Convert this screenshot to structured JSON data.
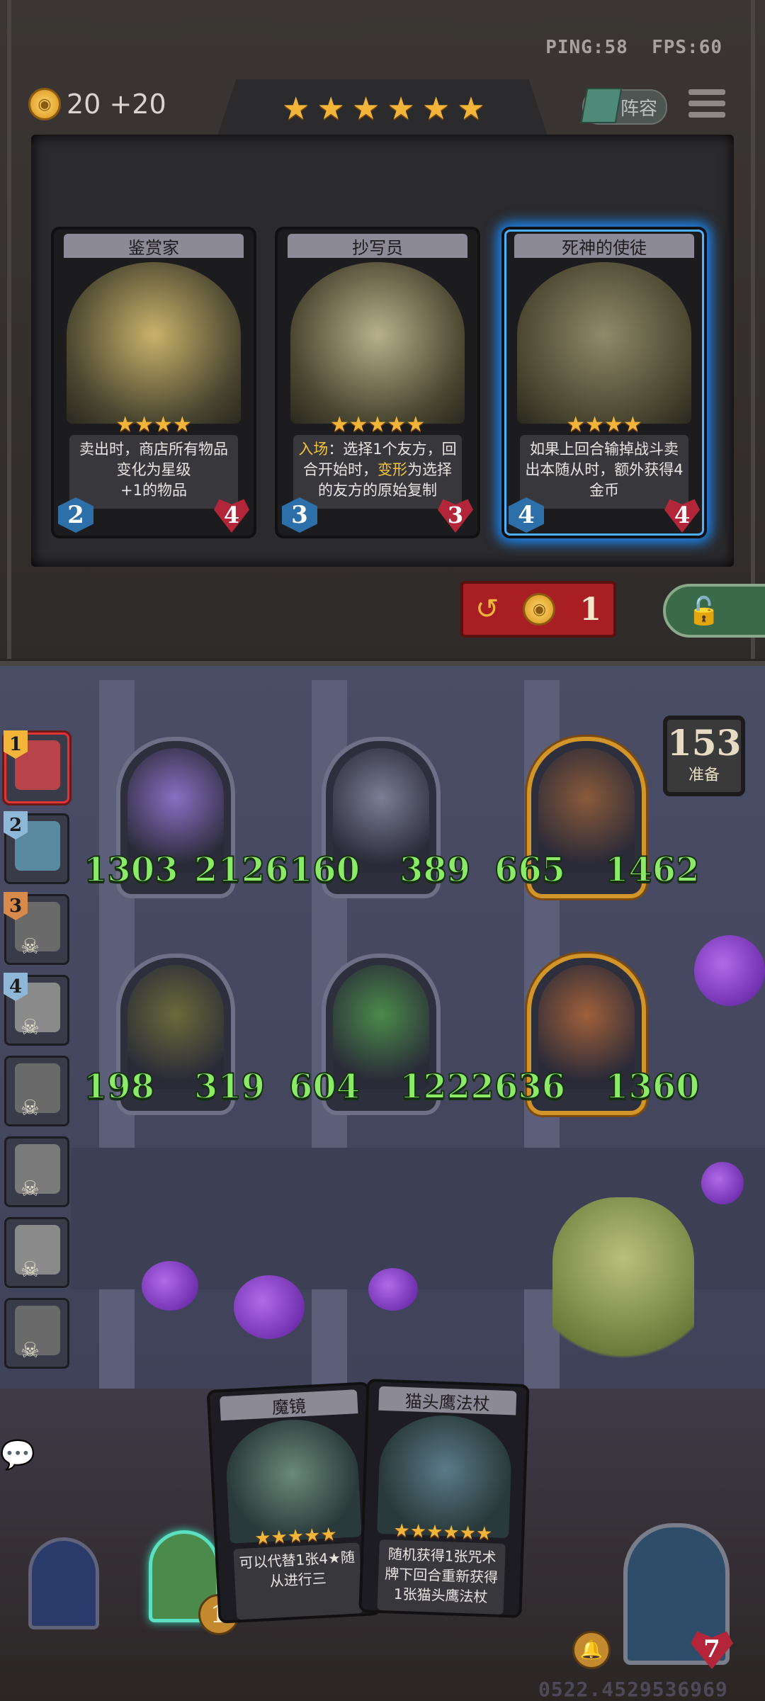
{
  "status": {
    "ping": "PING:58",
    "fps": "FPS:60"
  },
  "gold": {
    "amount": "20",
    "income": "+20"
  },
  "tier_stars": 6,
  "lineup_label": "阵容",
  "shop_cards": [
    {
      "name": "鉴赏家",
      "stars": 4,
      "desc_html": "卖出时，商店所有物品变化为星级<br>+1的物品",
      "attack": "2",
      "health": "4",
      "selected": false,
      "art_color": "#c9b26a"
    },
    {
      "name": "抄写员",
      "stars": 5,
      "desc_html": "<span class='hl'>入场</span>：选择1个友方，回合开始时，<span class='hl'>变形</span>为选择的友方的原始复制",
      "attack": "3",
      "health": "3",
      "selected": false,
      "art_color": "#b7b08a"
    },
    {
      "name": "死神的使徒",
      "stars": 4,
      "desc_html": "如果上回合输掉战斗卖出本随从时，额外获得4金币",
      "attack": "4",
      "health": "4",
      "selected": true,
      "art_color": "#8f8a6a"
    }
  ],
  "refresh": {
    "cost": "1"
  },
  "prep": {
    "timer": "153",
    "label": "准备"
  },
  "players": [
    {
      "rank": "1",
      "active": true,
      "eliminated": false,
      "rank_color": "#f2b53a",
      "face": "#b8434a"
    },
    {
      "rank": "2",
      "active": false,
      "eliminated": false,
      "rank_color": "#8fb7d8",
      "face": "#5a8aa0"
    },
    {
      "rank": "3",
      "active": false,
      "eliminated": true,
      "rank_color": "#d88a4a",
      "face": "#6a6a6a"
    },
    {
      "rank": "4",
      "active": false,
      "eliminated": true,
      "rank_color": "#8fb7d8",
      "face": "#8a8a8a"
    },
    {
      "rank": "",
      "active": false,
      "eliminated": true,
      "rank_color": "",
      "face": "#6a6a6a"
    },
    {
      "rank": "",
      "active": false,
      "eliminated": true,
      "rank_color": "",
      "face": "#7a7a7a"
    },
    {
      "rank": "",
      "active": false,
      "eliminated": true,
      "rank_color": "",
      "face": "#8a8a8a"
    },
    {
      "rank": "",
      "active": false,
      "eliminated": true,
      "rank_color": "",
      "face": "#6a6a6a"
    }
  ],
  "board": [
    {
      "attack": "1303",
      "health": "2126",
      "gold": false,
      "art": "#8a6fc4"
    },
    {
      "attack": "160",
      "health": "389",
      "gold": false,
      "art": "#7a7f95"
    },
    {
      "attack": "665",
      "health": "1462",
      "gold": true,
      "art": "#8a5a3a"
    },
    {
      "attack": "198",
      "health": "319",
      "gold": false,
      "art": "#6a6a3a"
    },
    {
      "attack": "604",
      "health": "1222",
      "gold": false,
      "art": "#4a8a4a"
    },
    {
      "attack": "636",
      "health": "1360",
      "gold": true,
      "art": "#a0603a"
    }
  ],
  "hand_cards": [
    {
      "name": "魔镜",
      "stars": 5,
      "desc_html": "可以代替1张4★随从进行三",
      "art_color": "#6a8a7a"
    },
    {
      "name": "猫头鹰法杖",
      "stars": 6,
      "desc_html": "随机获得1张咒术牌下回合重新获得1张猫头鹰法杖",
      "art_color": "#5a7a8a"
    }
  ],
  "deck_count": "1",
  "hero_health": "7",
  "footer_id": "0522.4529536969"
}
